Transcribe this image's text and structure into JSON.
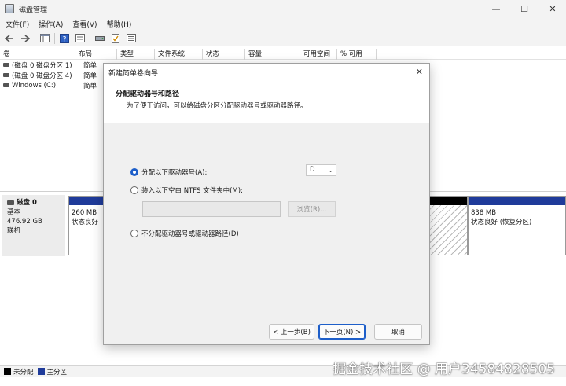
{
  "window": {
    "title": "磁盘管理",
    "controls": {
      "minimize": "—",
      "maximize": "☐",
      "close": "✕"
    }
  },
  "menu": [
    "文件(F)",
    "操作(A)",
    "查看(V)",
    "帮助(H)"
  ],
  "toolbar_icons": [
    "back-arrow-icon",
    "forward-arrow-icon",
    "console-tree-icon",
    "help-icon",
    "properties-icon",
    "disk-icon",
    "check-icon",
    "list-icon"
  ],
  "volume_table": {
    "columns": [
      "卷",
      "布局",
      "类型",
      "文件系统",
      "状态",
      "容量",
      "可用空间",
      "% 可用"
    ],
    "rows": [
      {
        "name": "(磁盘 0 磁盘分区 1)",
        "layout": "简单"
      },
      {
        "name": "(磁盘 0 磁盘分区 4)",
        "layout": "简单"
      },
      {
        "name": "Windows (C:)",
        "layout": "简单"
      }
    ]
  },
  "disk": {
    "name": "磁盘 0",
    "type": "基本",
    "size": "476.92 GB",
    "status": "联机"
  },
  "partitions": [
    {
      "size": "260 MB",
      "status": "状态良好"
    },
    {
      "size": "838 MB",
      "status": "状态良好 (恢复分区)"
    }
  ],
  "legend": [
    {
      "label": "未分配",
      "color": "#000000"
    },
    {
      "label": "主分区",
      "color": "#1f3b9a"
    }
  ],
  "watermark": "掘金技术社区 @ 用户34584828505",
  "dialog": {
    "title": "新建简单卷向导",
    "close": "✕",
    "heading": "分配驱动器号和路径",
    "subheading": "为了便于访问，可以给磁盘分区分配驱动器号或驱动器路径。",
    "option_assign": "分配以下驱动器号(A):",
    "drive_letter": "D",
    "option_mount": "装入以下空白 NTFS 文件夹中(M):",
    "path_value": "",
    "browse": "浏览(R)...",
    "option_none": "不分配驱动器号或驱动器路径(D)",
    "back": "< 上一步(B)",
    "next": "下一页(N) >",
    "cancel": "取消"
  },
  "colors": {
    "accent": "#1d5ec9",
    "primary_partition": "#1f3b9a",
    "unallocated": "#000000"
  }
}
